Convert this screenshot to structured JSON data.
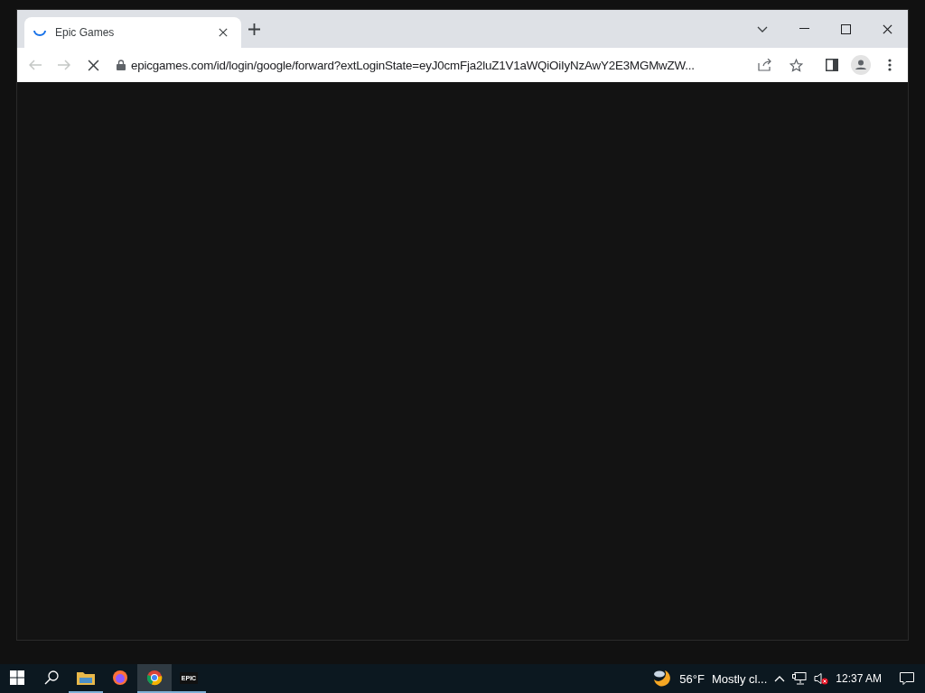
{
  "browser": {
    "tabs": [
      {
        "title": "Epic Games",
        "selected": true,
        "loading": true
      }
    ],
    "address": "epicgames.com/id/login/google/forward?extLoginState=eyJ0cmFja2luZ1V1aWQiOiIyNzAwY2E3MGMwZW...",
    "loading": true
  },
  "taskbar": {
    "apps": [
      {
        "kind": "folder",
        "running": true,
        "selected": false
      },
      {
        "kind": "firefox",
        "running": false,
        "selected": false
      },
      {
        "kind": "chrome",
        "running": true,
        "selected": true
      },
      {
        "kind": "epic",
        "running": true,
        "selected": false,
        "label": "EPIC"
      }
    ],
    "weather": {
      "temperature": "56°F",
      "condition": "Mostly cl..."
    },
    "time": "12:37 AM",
    "sound_muted": true
  }
}
